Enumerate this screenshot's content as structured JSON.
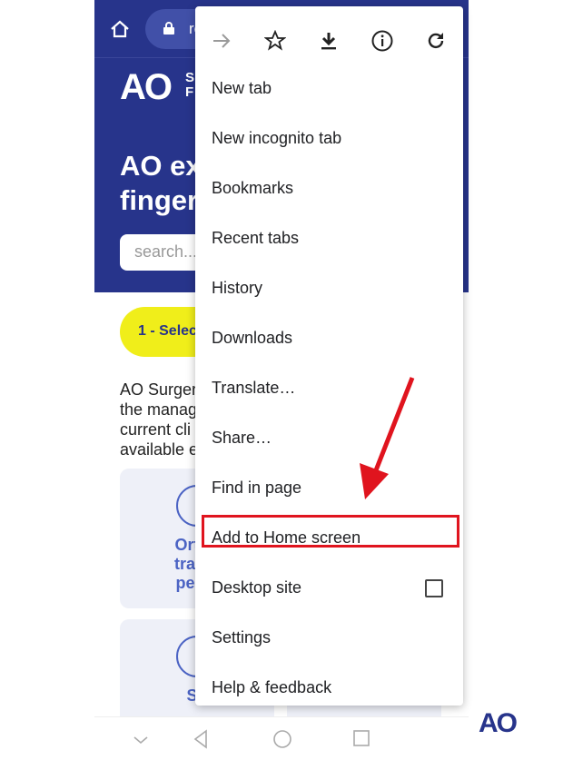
{
  "browser": {
    "url_partial": "re"
  },
  "page": {
    "logo": "AO",
    "logo_sub": [
      "S",
      "F"
    ],
    "title_lines": [
      "AO ex",
      "finger"
    ],
    "search_placeholder": "search...",
    "step_button": "1 - Selec",
    "intro_lines": [
      "AO Surger",
      "the manag",
      "current cli",
      "available e"
    ],
    "cards": [
      {
        "label_lines": [
          "Ortho",
          "traum",
          "pedia"
        ]
      },
      {
        "label_lines": [
          "Sp"
        ]
      }
    ]
  },
  "menu": {
    "icons": [
      "forward-icon",
      "star-icon",
      "download-icon",
      "info-icon",
      "refresh-icon"
    ],
    "items": [
      "New tab",
      "New incognito tab",
      "Bookmarks",
      "Recent tabs",
      "History",
      "Downloads",
      "Translate…",
      "Share…",
      "Find in page",
      "Add to Home screen",
      "Desktop site",
      "Settings",
      "Help & feedback"
    ],
    "desktop_site_checked": false,
    "highlighted_item": "Add to Home screen"
  },
  "annotation_color": "#e0141e",
  "brand_color": "#27348b",
  "corner_logo": "AO"
}
